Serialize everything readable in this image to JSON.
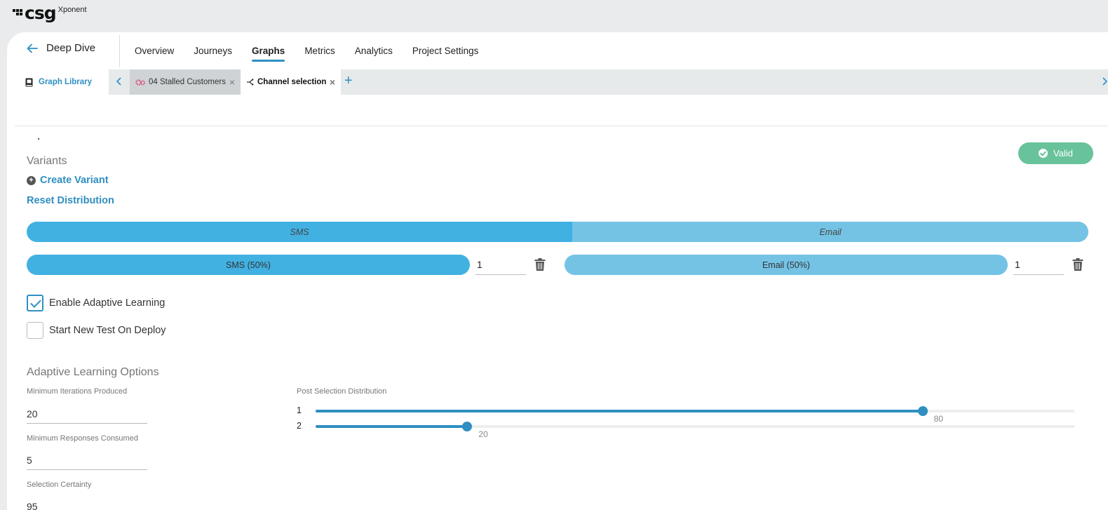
{
  "brand": {
    "name": "csg",
    "product": "Xponent"
  },
  "header": {
    "back_label": "Deep Dive",
    "nav": [
      "Overview",
      "Journeys",
      "Graphs",
      "Metrics",
      "Analytics",
      "Project Settings"
    ],
    "active_nav": "Graphs"
  },
  "tabs": {
    "library_label": "Graph Library",
    "open": [
      {
        "label": "04 Stalled Customers",
        "icon": "gears-icon"
      },
      {
        "label": "Channel selection",
        "icon": "branch-icon",
        "active": true
      }
    ]
  },
  "status": {
    "label": "Valid",
    "color": "#68c29a"
  },
  "variants": {
    "title": "Variants",
    "create_label": "Create Variant",
    "reset_label": "Reset Distribution",
    "distribution": [
      {
        "label": "SMS",
        "share": 0.5,
        "color": "#41b1e2"
      },
      {
        "label": "Email",
        "share": 0.5,
        "color": "#74c3e5"
      }
    ],
    "items": [
      {
        "label": "SMS (50%)",
        "weight": "1"
      },
      {
        "label": "Email (50%)",
        "weight": "1"
      }
    ]
  },
  "options": {
    "adaptive_learning": {
      "label": "Enable Adaptive Learning",
      "checked": true
    },
    "new_test_on_deploy": {
      "label": "Start New Test On Deploy",
      "checked": false
    }
  },
  "adaptive": {
    "title": "Adaptive Learning Options",
    "min_iterations_label": "Minimum Iterations Produced",
    "min_iterations_value": "20",
    "min_responses_label": "Minimum Responses Consumed",
    "min_responses_value": "5",
    "selection_certainty_label": "Selection Certainty",
    "selection_certainty_value": "95",
    "post_selection_label": "Post Selection Distribution",
    "sliders": [
      {
        "index": "1",
        "value": 80
      },
      {
        "index": "2",
        "value": 20
      }
    ]
  },
  "colors": {
    "accent": "#2f8fc2",
    "valid": "#68c29a"
  }
}
